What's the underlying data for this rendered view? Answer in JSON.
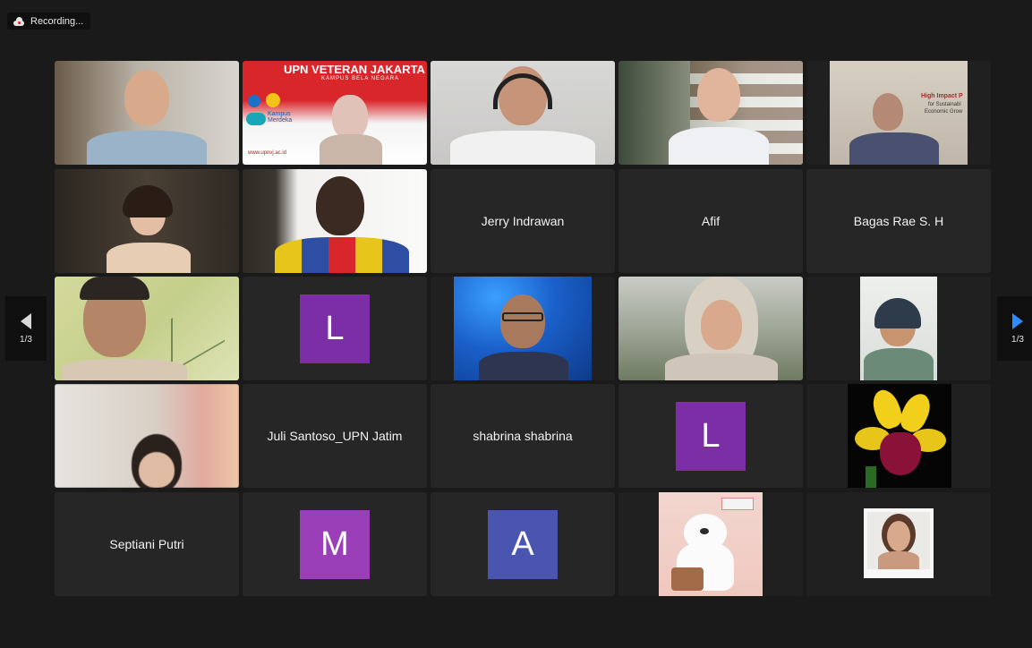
{
  "recording": {
    "label": "Recording..."
  },
  "pagination": {
    "left_label": "1/3",
    "right_label": "1/3"
  },
  "participants": {
    "row2": {
      "p3": "Jerry Indrawan",
      "p4": "Afif",
      "p5": "Bagas Rae S. H"
    },
    "row3": {
      "p2_initial": "L"
    },
    "row4": {
      "p2": "Juli Santoso_UPN Jatim",
      "p3": "shabrina shabrina",
      "p4_initial": "L"
    },
    "row5": {
      "p1": "Septiani Putri",
      "p2_initial": "M",
      "p3_initial": "A"
    }
  },
  "banner": {
    "title": "UPN VETERAN JAKARTA",
    "subtitle": "KAMPUS BELA NEGARA",
    "url": "www.upnvj.ac.id",
    "kampus": "Kampus Merdeka"
  },
  "slide": {
    "title": "High Impact P",
    "line2": "for Sustainabl",
    "line3": "Economic Grow"
  },
  "colors": {
    "avatar_purple": "#7b2ea6",
    "avatar_magenta": "#9b3fb8",
    "avatar_blue": "#4a55b0",
    "active_border": "#23d160",
    "nav_active": "#2d8cff"
  },
  "icons": {
    "recording": "cloud-record-icon",
    "prev": "chevron-left-icon",
    "next": "chevron-right-icon"
  }
}
